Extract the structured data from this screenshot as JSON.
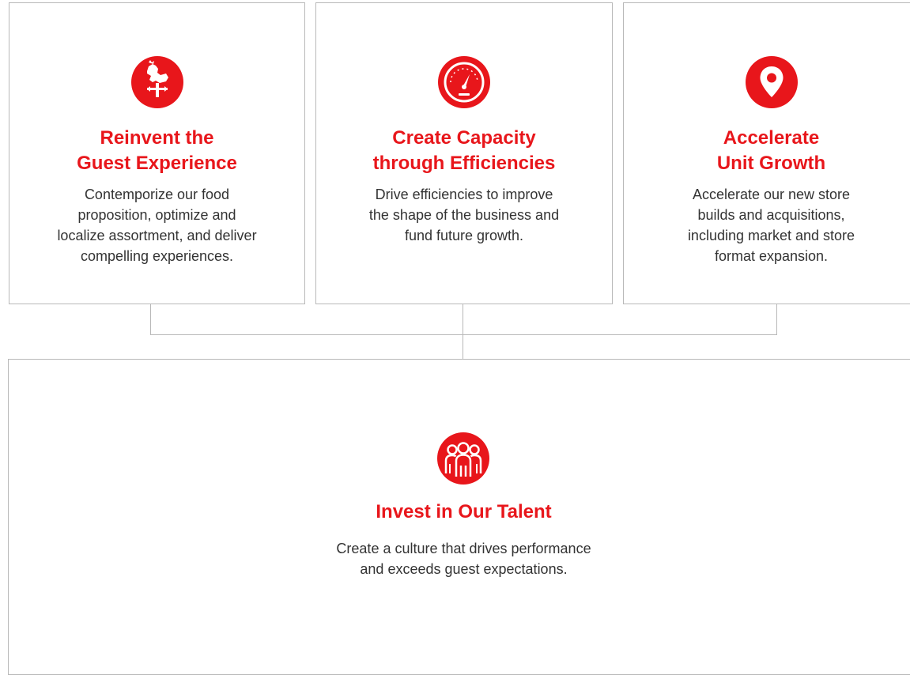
{
  "accent_color": "#e8161b",
  "pillars": [
    {
      "icon": "rooster-weathervane-icon",
      "title_line1": "Reinvent the",
      "title_line2": "Guest Experience",
      "desc_line1": "Contemporize our food",
      "desc_line2": "proposition, optimize and",
      "desc_line3": "localize assortment, and deliver",
      "desc_line4": "compelling experiences."
    },
    {
      "icon": "speedometer-icon",
      "title_line1": "Create Capacity",
      "title_line2": "through Efficiencies",
      "desc_line1": "Drive efficiencies to improve",
      "desc_line2": "the shape of the business and",
      "desc_line3": "fund future growth."
    },
    {
      "icon": "location-pin-icon",
      "title_line1": "Accelerate",
      "title_line2": "Unit Growth",
      "desc_line1": "Accelerate our new store",
      "desc_line2": "builds and acquisitions,",
      "desc_line3": "including market and store",
      "desc_line4": "format expansion."
    }
  ],
  "foundation": {
    "icon": "people-group-icon",
    "title": "Invest in Our Talent",
    "desc_line1": "Create a culture that drives performance",
    "desc_line2": "and exceeds guest expectations."
  }
}
